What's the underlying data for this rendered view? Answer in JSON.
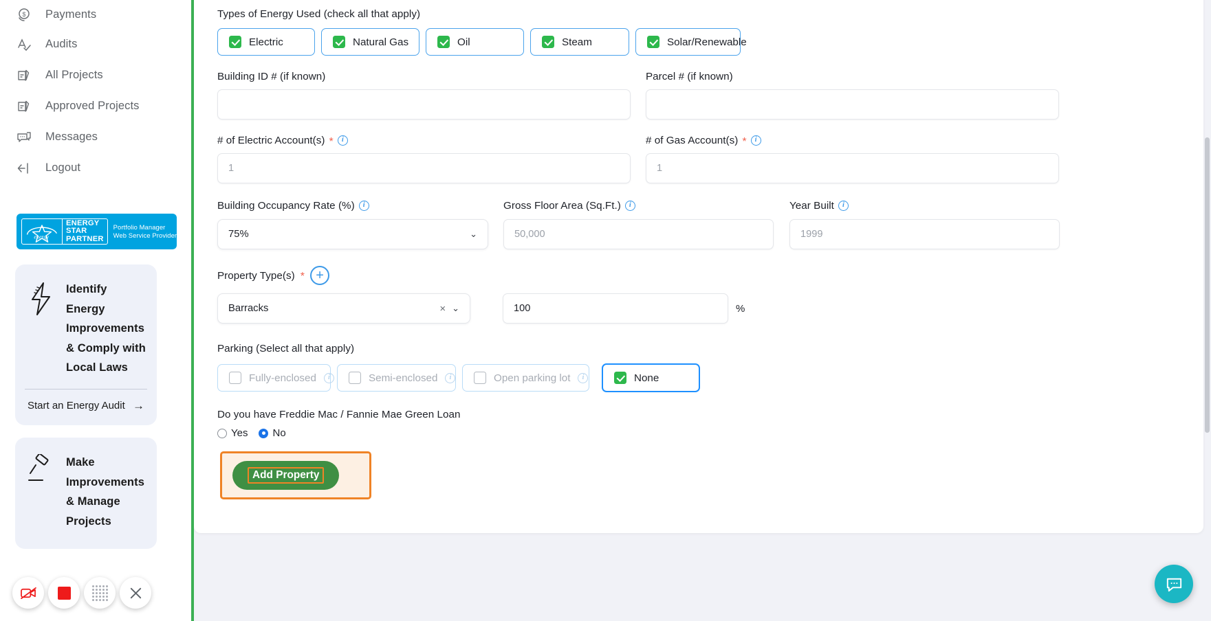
{
  "sidebar": {
    "nav_items": [
      {
        "label": "Payments",
        "icon": "payments-icon"
      },
      {
        "label": "Audits",
        "icon": "audits-icon"
      },
      {
        "label": "All Projects",
        "icon": "projects-icon"
      },
      {
        "label": "Approved Projects",
        "icon": "approved-projects-icon"
      },
      {
        "label": "Messages",
        "icon": "messages-icon"
      },
      {
        "label": "Logout",
        "icon": "logout-icon"
      }
    ],
    "badge": {
      "line1": "ENERGY",
      "line2": "STAR",
      "line3": "PARTNER",
      "tag_line1": "Portfolio Manager",
      "tag_line2": "Web Service Provider",
      "bg_color": "#00a3e0"
    },
    "promos": [
      {
        "icon": "lightning-bolt-icon",
        "lines": [
          "Identify",
          "Energy",
          "Improvements",
          "& Comply with",
          "Local Laws"
        ],
        "cta": "Start an Energy Audit",
        "cta_arrow": "→"
      },
      {
        "icon": "gavel-icon",
        "lines": [
          "Make",
          "Improvements",
          "& Manage",
          "Projects"
        ],
        "cta": "",
        "cta_arrow": ""
      }
    ]
  },
  "form": {
    "energy_types": {
      "label": "Types of Energy Used (check all that apply)",
      "options": [
        {
          "label": "Electric",
          "checked": true
        },
        {
          "label": "Natural Gas",
          "checked": true
        },
        {
          "label": "Oil",
          "checked": true
        },
        {
          "label": "Steam",
          "checked": true
        },
        {
          "label": "Solar/Renewable",
          "checked": true
        }
      ]
    },
    "building_id": {
      "label": "Building ID # (if known)",
      "value": "",
      "placeholder": ""
    },
    "parcel": {
      "label": "Parcel # (if known)",
      "value": "",
      "placeholder": ""
    },
    "electric_accounts": {
      "label": "# of Electric Account(s)",
      "required": "*",
      "placeholder": "1",
      "value": ""
    },
    "gas_accounts": {
      "label": "# of Gas Account(s)",
      "required": "*",
      "placeholder": "1",
      "value": ""
    },
    "occupancy": {
      "label": "Building Occupancy Rate (%)",
      "value": "75%"
    },
    "gross_floor_area": {
      "label": "Gross Floor Area (Sq.Ft.)",
      "placeholder": "50,000",
      "value": ""
    },
    "year_built": {
      "label": "Year Built",
      "placeholder": "1999",
      "value": ""
    },
    "property_types": {
      "label": "Property Type(s)",
      "required": "*",
      "add_label": "+",
      "selected": "Barracks",
      "clear": "×",
      "percent_value": "100",
      "percent_symbol": "%"
    },
    "parking": {
      "label": "Parking (Select all that apply)",
      "options": [
        {
          "label": "Fully-enclosed",
          "checked": false,
          "disabled": true,
          "info": true
        },
        {
          "label": "Semi-enclosed",
          "checked": false,
          "disabled": true,
          "info": true
        },
        {
          "label": "Open parking lot",
          "checked": false,
          "disabled": true,
          "info": true
        },
        {
          "label": "None",
          "checked": true,
          "disabled": false,
          "info": false
        }
      ]
    },
    "green_loan": {
      "label": "Do you have Freddie Mac / Fannie Mae Green Loan",
      "options": [
        {
          "label": "Yes",
          "selected": false
        },
        {
          "label": "No",
          "selected": true
        }
      ]
    },
    "submit": {
      "label": "Add Property",
      "highlight_color": "#ef8326",
      "button_color": "#3f8f43"
    }
  },
  "toolbar": {
    "buttons": [
      {
        "name": "camera-off-icon",
        "label": ""
      },
      {
        "name": "stop-recording-icon",
        "label": ""
      },
      {
        "name": "drag-handle-icon",
        "label": ""
      },
      {
        "name": "close-icon",
        "label": ""
      }
    ]
  },
  "chat": {
    "icon": "chat-bubble-icon"
  }
}
